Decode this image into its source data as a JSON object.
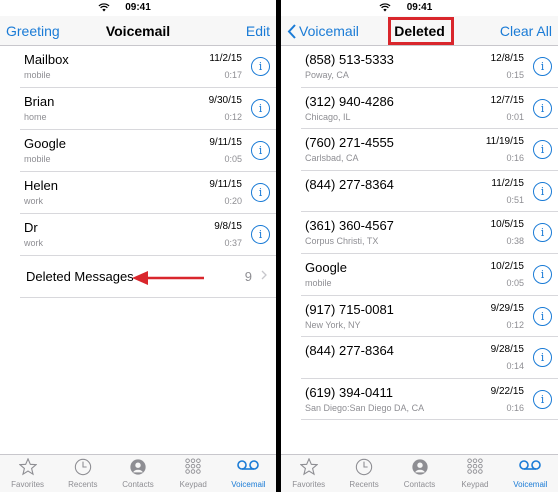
{
  "status": {
    "time": "09:41"
  },
  "left": {
    "nav": {
      "left": "Greeting",
      "title": "Voicemail",
      "right": "Edit"
    },
    "items": [
      {
        "name": "Mailbox",
        "sub": "mobile",
        "date": "11/2/15",
        "dur": "0:17"
      },
      {
        "name": "Brian",
        "sub": "home",
        "date": "9/30/15",
        "dur": "0:12"
      },
      {
        "name": "Google",
        "sub": "mobile",
        "date": "9/11/15",
        "dur": "0:05"
      },
      {
        "name": "Helen",
        "sub": "work",
        "date": "9/11/15",
        "dur": "0:20"
      },
      {
        "name": "Dr",
        "sub": "work",
        "date": "9/8/15",
        "dur": "0:37"
      }
    ],
    "deleted": {
      "label": "Deleted Messages",
      "count": "9"
    }
  },
  "right": {
    "nav": {
      "left": "Voicemail",
      "title": "Deleted",
      "right": "Clear All"
    },
    "items": [
      {
        "name": "(858) 513-5333",
        "sub": "Poway, CA",
        "date": "12/8/15",
        "dur": "0:15"
      },
      {
        "name": "(312) 940-4286",
        "sub": "Chicago, IL",
        "date": "12/7/15",
        "dur": "0:01"
      },
      {
        "name": "(760) 271-4555",
        "sub": "Carlsbad, CA",
        "date": "11/19/15",
        "dur": "0:16"
      },
      {
        "name": "(844) 277-8364",
        "sub": "",
        "date": "11/2/15",
        "dur": "0:51"
      },
      {
        "name": "(361) 360-4567",
        "sub": "Corpus Christi, TX",
        "date": "10/5/15",
        "dur": "0:38"
      },
      {
        "name": "Google",
        "sub": "mobile",
        "date": "10/2/15",
        "dur": "0:05"
      },
      {
        "name": "(917) 715-0081",
        "sub": "New York, NY",
        "date": "9/29/15",
        "dur": "0:12"
      },
      {
        "name": "(844) 277-8364",
        "sub": "",
        "date": "9/28/15",
        "dur": "0:14"
      },
      {
        "name": "(619) 394-0411",
        "sub": "San Diego:San Diego DA, CA",
        "date": "9/22/15",
        "dur": "0:16"
      }
    ]
  },
  "tabs": [
    "Favorites",
    "Recents",
    "Contacts",
    "Keypad",
    "Voicemail"
  ],
  "right_tabs_visible": [
    "Favorites",
    "Recents",
    "Contacts",
    "Keypad",
    "Voicemail"
  ],
  "colors": {
    "accent": "#1a7bd6",
    "highlight": "#d9262c"
  }
}
